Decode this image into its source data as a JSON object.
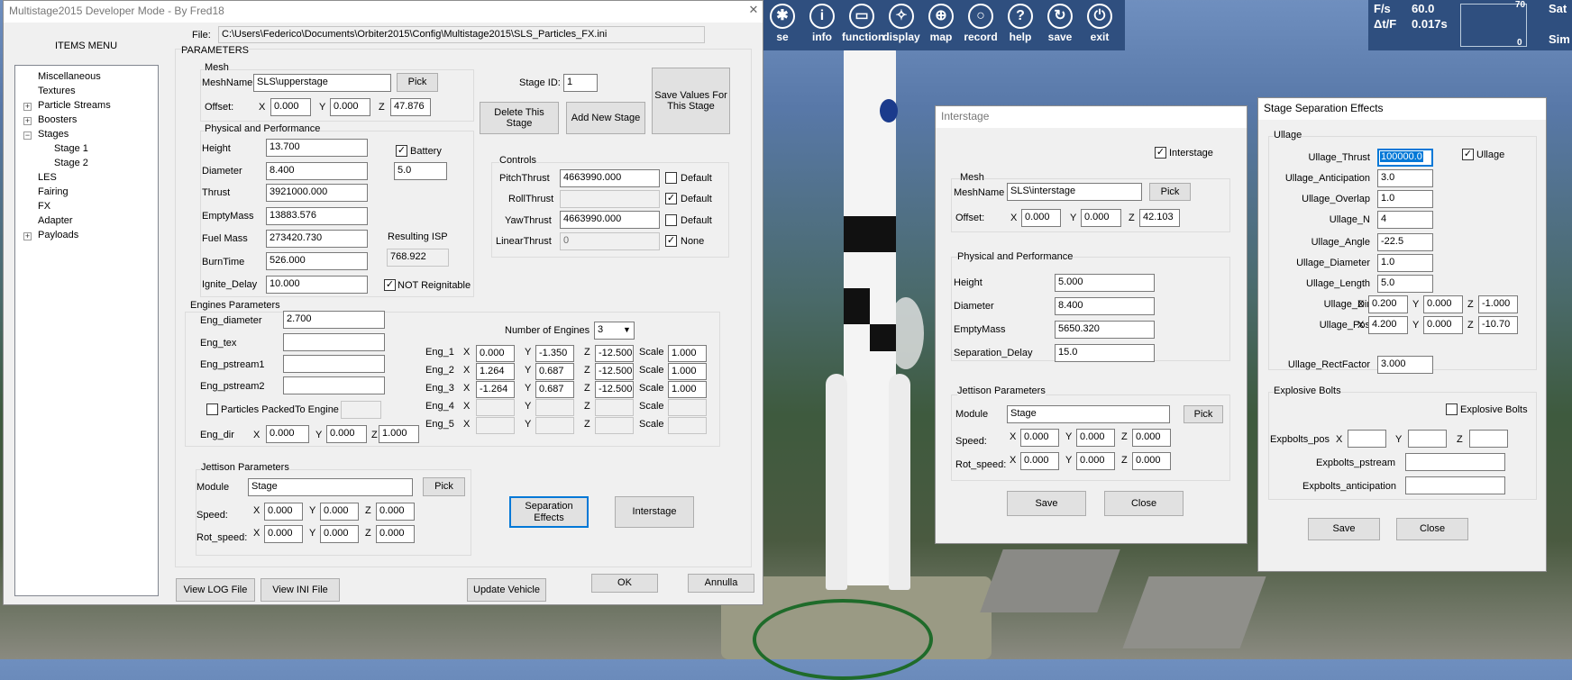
{
  "sim": {
    "toolbar": [
      {
        "label": "se",
        "icon": "settings-icon",
        "glyph": "✱"
      },
      {
        "label": "info",
        "icon": "info-icon",
        "glyph": "i"
      },
      {
        "label": "function",
        "icon": "function-icon",
        "glyph": "▭"
      },
      {
        "label": "display",
        "icon": "display-icon",
        "glyph": "✧"
      },
      {
        "label": "map",
        "icon": "map-icon",
        "glyph": "⊕"
      },
      {
        "label": "record",
        "icon": "record-icon",
        "glyph": "○"
      },
      {
        "label": "help",
        "icon": "help-icon",
        "glyph": "?"
      },
      {
        "label": "save",
        "icon": "save-icon",
        "glyph": "↻"
      },
      {
        "label": "exit",
        "icon": "exit-icon",
        "glyph": "⏻"
      }
    ],
    "hud": {
      "fps_label": "F/s",
      "fps_value": "60.0",
      "dt_label": "Δt/F",
      "dt_value": "0.017s",
      "graph_max": "70",
      "graph_min": "0",
      "right_line1": "Sat",
      "right_line2": "Sim"
    }
  },
  "main": {
    "title": "Multistage2015 Developer Mode - By Fred18",
    "items_menu": "ITEMS MENU",
    "file_label": "File:",
    "file_path": "C:\\Users\\Federico\\Documents\\Orbiter2015\\Config\\Multistage2015\\SLS_Particles_FX.ini",
    "tree": [
      {
        "label": "Miscellaneous",
        "level": 0,
        "exp": ""
      },
      {
        "label": "Textures",
        "level": 0,
        "exp": ""
      },
      {
        "label": "Particle Streams",
        "level": 0,
        "exp": "+"
      },
      {
        "label": "Boosters",
        "level": 0,
        "exp": "+"
      },
      {
        "label": "Stages",
        "level": 0,
        "exp": "−"
      },
      {
        "label": "Stage 1",
        "level": 1,
        "exp": ""
      },
      {
        "label": "Stage 2",
        "level": 1,
        "exp": ""
      },
      {
        "label": "LES",
        "level": 0,
        "exp": ""
      },
      {
        "label": "Fairing",
        "level": 0,
        "exp": ""
      },
      {
        "label": "FX",
        "level": 0,
        "exp": ""
      },
      {
        "label": "Adapter",
        "level": 0,
        "exp": ""
      },
      {
        "label": "Payloads",
        "level": 0,
        "exp": "+"
      }
    ],
    "parameters": "PARAMETERS",
    "mesh": {
      "title": "Mesh",
      "meshname_label": "MeshName",
      "meshname": "SLS\\upperstage",
      "pick": "Pick",
      "offset_label": "Offset:",
      "x": "X",
      "y": "Y",
      "z": "Z",
      "ox": "0.000",
      "oy": "0.000",
      "oz": "47.876"
    },
    "stage_id_label": "Stage ID:",
    "stage_id": "1",
    "delete_stage": "Delete This Stage",
    "add_stage": "Add New Stage",
    "save_values": "Save Values For This Stage",
    "phys": {
      "title": "Physical and Performance",
      "height_label": "Height",
      "height": "13.700",
      "diameter_label": "Diameter",
      "diameter": "8.400",
      "thrust_label": "Thrust",
      "thrust": "3921000.000",
      "emptymass_label": "EmptyMass",
      "emptymass": "13883.576",
      "fuelmass_label": "Fuel Mass",
      "fuelmass": "273420.730",
      "burntime_label": "BurnTime",
      "burntime": "526.000",
      "ignite_label": "Ignite_Delay",
      "ignite": "10.000",
      "battery_label": "Battery",
      "battery": "5.0",
      "isp_label": "Resulting ISP",
      "isp": "768.922",
      "reignitable_label": "NOT Reignitable"
    },
    "controls": {
      "title": "Controls",
      "pitch_label": "PitchThrust",
      "pitch": "4663990.000",
      "pitch_opt": "Default",
      "roll_label": "RollThrust",
      "roll": "",
      "roll_opt": "Default",
      "yaw_label": "YawThrust",
      "yaw": "4663990.000",
      "yaw_opt": "Default",
      "linear_label": "LinearThrust",
      "linear": "0",
      "linear_opt": "None"
    },
    "engines": {
      "title": "Engines Parameters",
      "diameter_label": "Eng_diameter",
      "diameter": "2.700",
      "tex_label": "Eng_tex",
      "pstream1_label": "Eng_pstream1",
      "pstream2_label": "Eng_pstream2",
      "num_label": "Number of Engines",
      "num": "3",
      "packed_label": "Particles Packed",
      "to_engine_label": "To Engine",
      "dir_label": "Eng_dir",
      "dx": "0.000",
      "dy": "0.000",
      "dz": "1.000",
      "scale_label": "Scale",
      "rows": [
        {
          "name": "Eng_1",
          "x": "0.000",
          "y": "-1.350",
          "z": "-12.500",
          "scale": "1.000"
        },
        {
          "name": "Eng_2",
          "x": "1.264",
          "y": "0.687",
          "z": "-12.500",
          "scale": "1.000"
        },
        {
          "name": "Eng_3",
          "x": "-1.264",
          "y": "0.687",
          "z": "-12.500",
          "scale": "1.000"
        },
        {
          "name": "Eng_4",
          "x": "",
          "y": "",
          "z": "",
          "scale": ""
        },
        {
          "name": "Eng_5",
          "x": "",
          "y": "",
          "z": "",
          "scale": ""
        }
      ]
    },
    "jettison": {
      "title": "Jettison Parameters",
      "module_label": "Module",
      "module": "Stage",
      "pick": "Pick",
      "speed_label": "Speed:",
      "rot_label": "Rot_speed:",
      "sx": "0.000",
      "sy": "0.000",
      "sz": "0.000",
      "rx": "0.000",
      "ry": "0.000",
      "rz": "0.000"
    },
    "sep_effects": "Separation Effects",
    "interstage_btn": "Interstage",
    "view_log": "View LOG File",
    "view_ini": "View INI File",
    "update_vehicle": "Update Vehicle",
    "ok": "OK",
    "annulla": "Annulla"
  },
  "interstage": {
    "title": "Interstage",
    "enable_label": "Interstage",
    "mesh_title": "Mesh",
    "meshname_label": "MeshName",
    "meshname": "SLS\\interstage",
    "pick": "Pick",
    "offset_label": "Offset:",
    "ox": "0.000",
    "oy": "0.000",
    "oz": "42.103",
    "phys_title": "Physical and Performance",
    "height_label": "Height",
    "height": "5.000",
    "diameter_label": "Diameter",
    "diameter": "8.400",
    "emptymass_label": "EmptyMass",
    "emptymass": "5650.320",
    "sepdelay_label": "Separation_Delay",
    "sepdelay": "15.0",
    "jet_title": "Jettison Parameters",
    "module_label": "Module",
    "module": "Stage",
    "jpick": "Pick",
    "speed_label": "Speed:",
    "rot_label": "Rot_speed:",
    "sx": "0.000",
    "sy": "0.000",
    "sz": "0.000",
    "rx": "0.000",
    "ry": "0.000",
    "rz": "0.000",
    "save": "Save",
    "close": "Close"
  },
  "sepfx": {
    "title": "Stage Separation Effects",
    "ullage_title": "Ullage",
    "ullage_chk": "Ullage",
    "thrust_label": "Ullage_Thrust",
    "thrust": "100000.0",
    "antic_label": "Ullage_Anticipation",
    "antic": "3.0",
    "overlap_label": "Ullage_Overlap",
    "overlap": "1.0",
    "n_label": "Ullage_N",
    "n": "4",
    "angle_label": "Ullage_Angle",
    "angle": "-22.5",
    "diam_label": "Ullage_Diameter",
    "diam": "1.0",
    "length_label": "Ullage_Length",
    "length": "5.0",
    "dir_label": "Ullage_Dir",
    "dx": "0.200",
    "dy": "0.000",
    "dz": "-1.000",
    "pos_label": "Ullage_Pos",
    "px": "4.200",
    "py": "0.000",
    "pz": "-10.70",
    "rect_label": "Ullage_RectFactor",
    "rect": "3.000",
    "bolts_title": "Explosive Bolts",
    "bolts_chk": "Explosive Bolts",
    "bpos_label": "Expbolts_pos",
    "bpstream_label": "Expbolts_pstream",
    "bantic_label": "Expbolts_anticipation",
    "save": "Save",
    "close": "Close"
  }
}
